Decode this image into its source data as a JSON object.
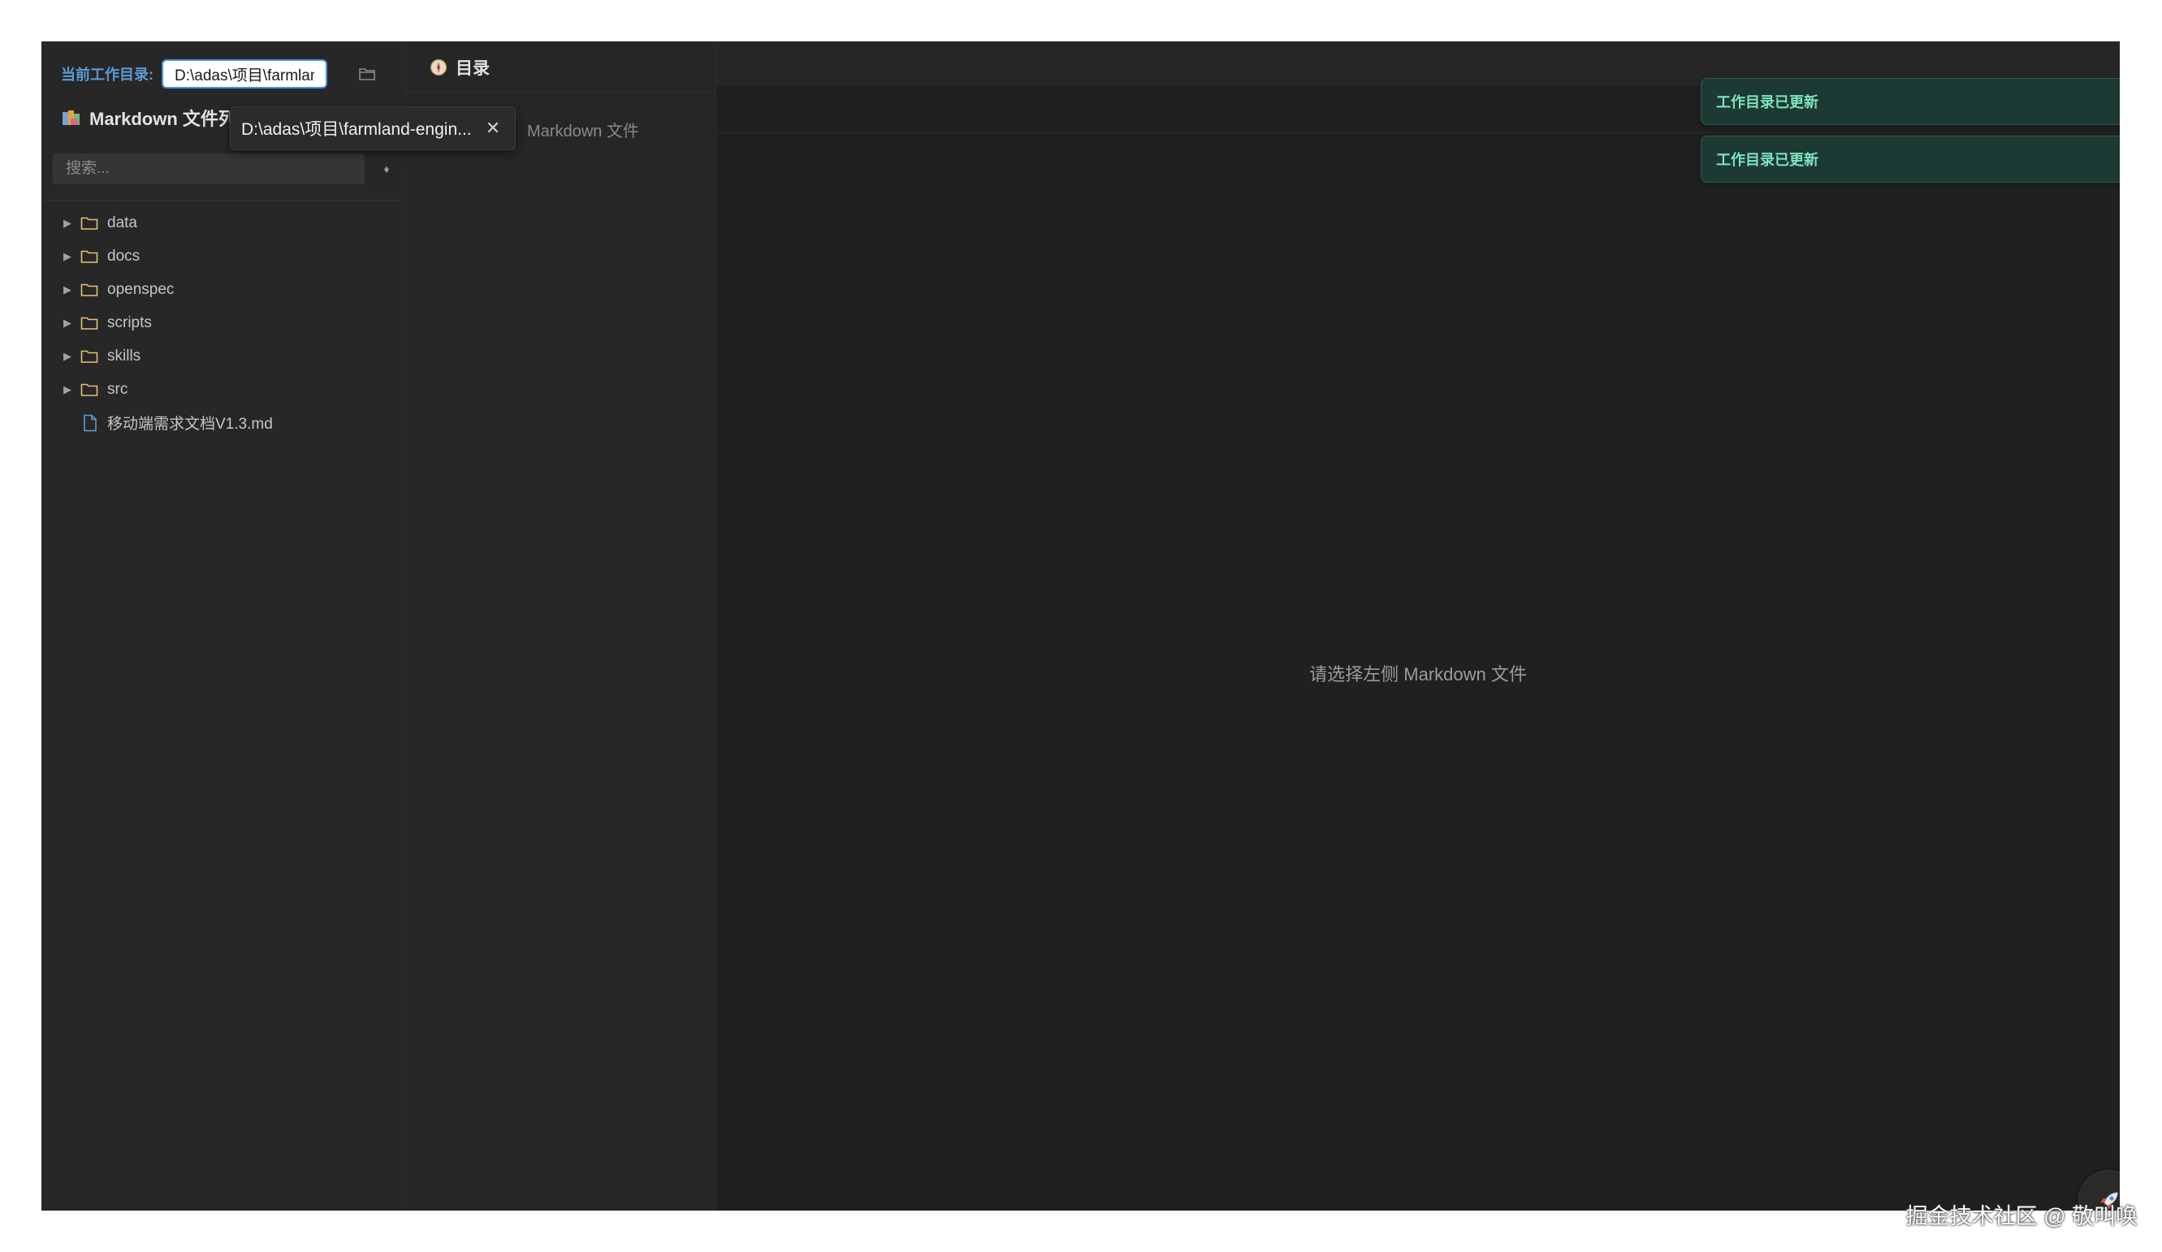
{
  "working_dir": {
    "label": "当前工作目录:",
    "value": "D:\\adas\\项目\\farmland-engin..."
  },
  "sidebar": {
    "title": "Markdown 文件列表",
    "search_placeholder": "搜索...",
    "tree": [
      {
        "type": "folder",
        "name": "data"
      },
      {
        "type": "folder",
        "name": "docs"
      },
      {
        "type": "folder",
        "name": "openspec"
      },
      {
        "type": "folder",
        "name": "scripts"
      },
      {
        "type": "folder",
        "name": "skills"
      },
      {
        "type": "folder",
        "name": "src"
      },
      {
        "type": "file",
        "name": "移动端需求文档V1.3.md"
      }
    ]
  },
  "tooltip": {
    "path": "D:\\adas\\项目\\farmland-engin..."
  },
  "toc": {
    "title": "目录",
    "hint": "Markdown 文件"
  },
  "main": {
    "empty_message": "请选择左侧 Markdown 文件"
  },
  "toasts": [
    {
      "text": "工作目录已更新"
    },
    {
      "text": "工作目录已更新"
    }
  ],
  "watermark": "掘金技术社区 @ 敬叫唤",
  "colors": {
    "accent": "#4a90e2",
    "folder": "#e5c07b",
    "file": "#5ba4d8",
    "toast_text": "#7fe3c0",
    "toast_bg": "#1c3a33"
  },
  "icons": {
    "folder": "folder-icon",
    "file": "file-icon",
    "browse": "folder-open-icon",
    "toc": "compass-icon",
    "close": "close-icon",
    "fab": "rocket-icon"
  }
}
